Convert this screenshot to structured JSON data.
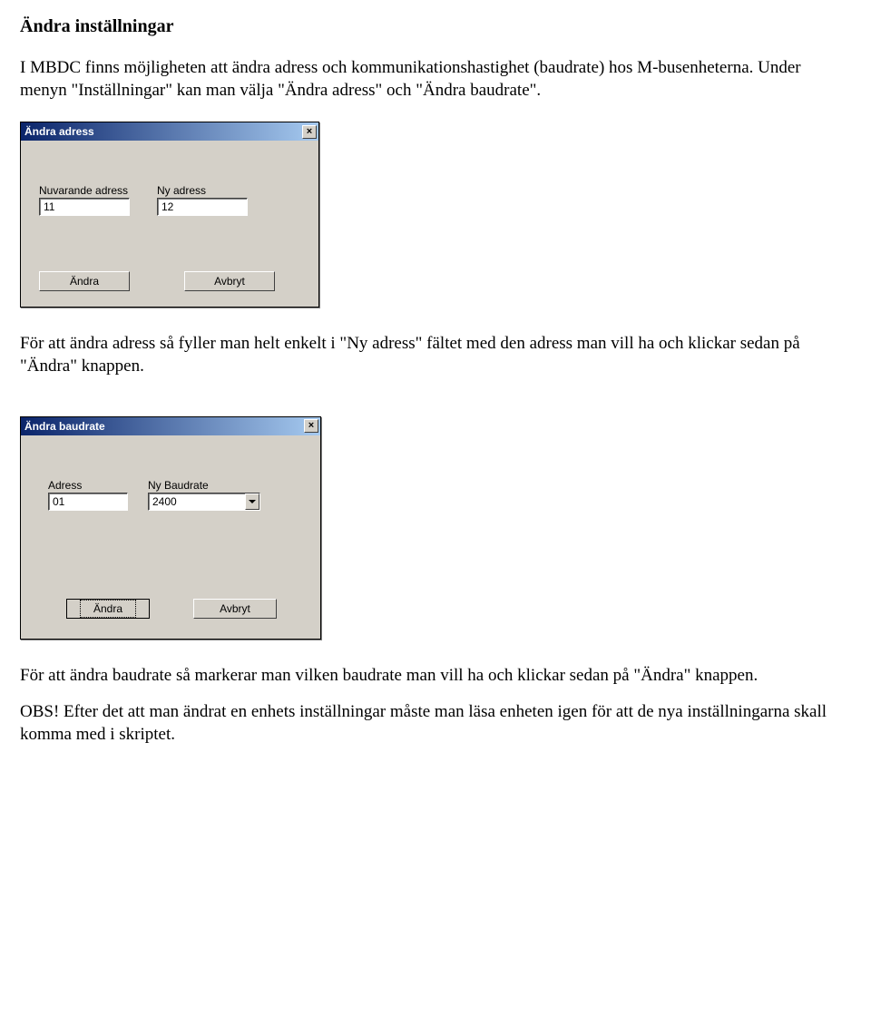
{
  "page": {
    "title": "Ändra inställningar",
    "para1": "I MBDC finns möjligheten att ändra adress och kommunikationshastighet (baudrate) hos M-busenheterna. Under menyn \"Inställningar\" kan man välja \"Ändra adress\" och \"Ändra baudrate\".",
    "para2": "För att ändra adress så fyller man helt enkelt i \"Ny adress\" fältet med den adress man vill ha och klickar sedan på \"Ändra\" knappen.",
    "para3": "För att ändra baudrate så markerar man vilken baudrate man vill ha och klickar sedan på \"Ändra\" knappen.",
    "para4": "OBS! Efter det att man ändrat en enhets inställningar måste man läsa enheten igen för att de nya inställningarna skall komma med i skriptet."
  },
  "dialog1": {
    "title": "Ändra adress",
    "current_label": "Nuvarande adress",
    "new_label": "Ny adress",
    "current_value": "11",
    "new_value": "12",
    "ok_label": "Ändra",
    "cancel_label": "Avbryt"
  },
  "dialog2": {
    "title": "Ändra baudrate",
    "adress_label": "Adress",
    "baud_label": "Ny Baudrate",
    "adress_value": "01",
    "baud_value": "2400",
    "ok_label": "Ändra",
    "cancel_label": "Avbryt"
  }
}
